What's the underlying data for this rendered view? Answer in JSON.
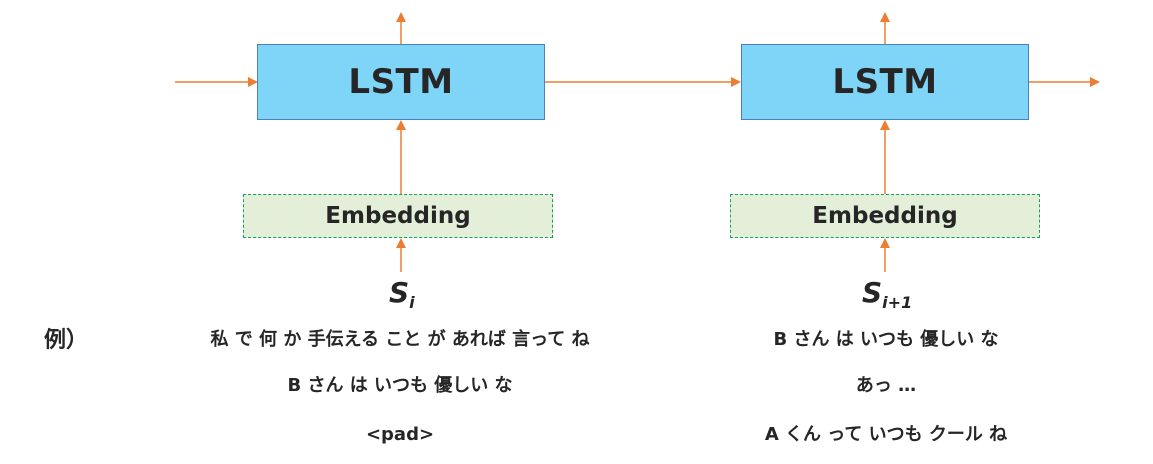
{
  "diagram": {
    "cells": [
      {
        "lstm_label": "LSTM",
        "embedding_label": "Embedding",
        "input_symbol": "S",
        "input_subscript": "i"
      },
      {
        "lstm_label": "LSTM",
        "embedding_label": "Embedding",
        "input_symbol": "S",
        "input_subscript": "i+1"
      }
    ],
    "colors": {
      "lstm_fill": "#7fd5f7",
      "lstm_border": "#4f7fb8",
      "embedding_fill": "#e3efd9",
      "embedding_border": "#1aa05a",
      "arrow": "#ed7d31"
    }
  },
  "example": {
    "heading": "例）",
    "left_lines": [
      "私 で 何 か 手伝える こと が あれば 言って ね",
      "B さん は いつも 優しい な",
      "<pad>"
    ],
    "right_lines": [
      "B さん は いつも 優しい な",
      "あっ …",
      "A くん って いつも クール ね"
    ]
  }
}
